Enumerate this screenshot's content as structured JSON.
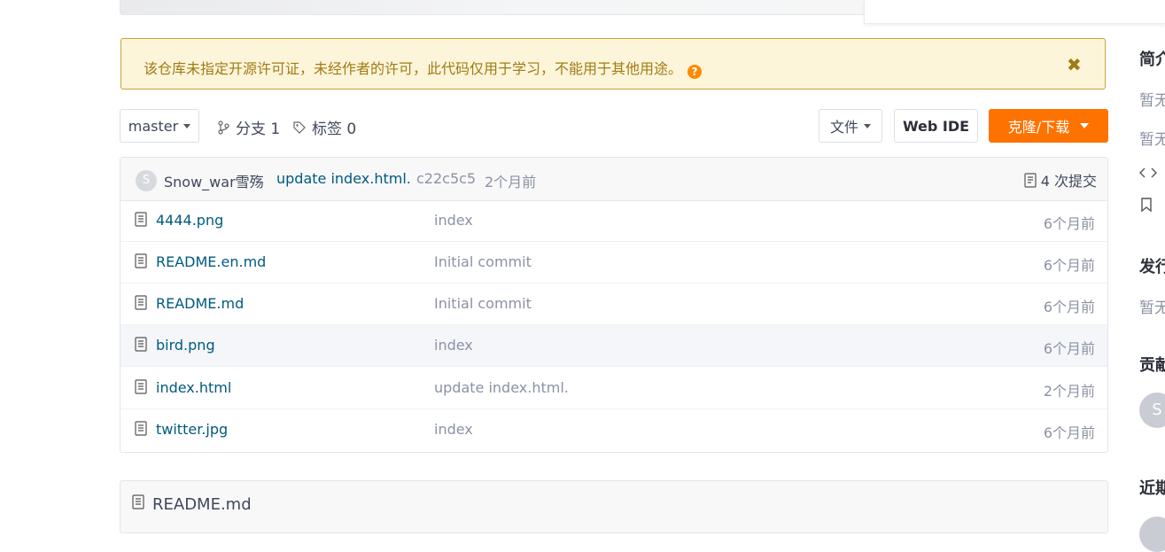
{
  "notice": {
    "text": "该仓库未指定开源许可证，未经作者的许可，此代码仅用于学习，不能用于其他用途。",
    "help": "?",
    "close": "✖"
  },
  "toolbar": {
    "branch": "master",
    "branches_label": "分支 1",
    "tags_label": "标签 0",
    "file_button": "文件",
    "webide_button": "Web IDE",
    "clone_button": "克隆/下载"
  },
  "commit": {
    "avatar_initial": "S",
    "author": "Snow_war雪殇",
    "message": "update index.html.",
    "hash": "c22c5c5",
    "time": "2个月前",
    "count_label": "4 次提交"
  },
  "files": [
    {
      "name": "4444.png",
      "message": "index",
      "time": "6个月前"
    },
    {
      "name": "README.en.md",
      "message": "Initial commit",
      "time": "6个月前"
    },
    {
      "name": "README.md",
      "message": "Initial commit",
      "time": "6个月前"
    },
    {
      "name": "bird.png",
      "message": "index",
      "time": "6个月前"
    },
    {
      "name": "index.html",
      "message": "update index.html.",
      "time": "2个月前"
    },
    {
      "name": "twitter.jpg",
      "message": "index",
      "time": "6个月前"
    }
  ],
  "readme": {
    "title": "README.md"
  },
  "sidebar": {
    "intro_heading": "简介",
    "intro_text_1": "暂无",
    "intro_text_2": "暂无",
    "releases_heading": "发行",
    "releases_text": "暂无",
    "contributors_heading": "贡献",
    "contributor_initial": "S",
    "recent_heading": "近期"
  },
  "colors": {
    "accent": "#fe7300",
    "link": "#005980",
    "notice_bg": "#fdf5da",
    "notice_border": "#c9a43d"
  }
}
